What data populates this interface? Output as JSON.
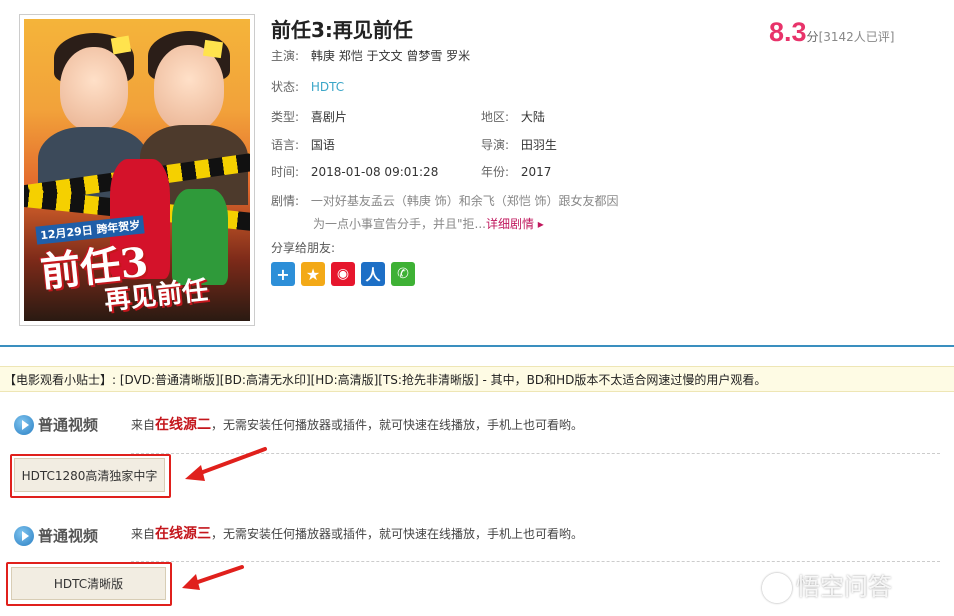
{
  "movie": {
    "title": "前任3:再见前任",
    "rating": "8.3",
    "rating_unit": "分",
    "rating_count": "[3142人已评]",
    "cast_label": "主演:",
    "cast": "韩庚 郑恺 于文文 曾梦雪 罗米",
    "status_label": "状态:",
    "status": "HDTC",
    "genre_label": "类型:",
    "genre": "喜剧片",
    "region_label": "地区:",
    "region": "大陆",
    "language_label": "语言:",
    "language": "国语",
    "director_label": "导演:",
    "director": "田羽生",
    "time_label": "时间:",
    "time": "2018-01-08 09:01:28",
    "year_label": "年份:",
    "year": "2017",
    "plot_label": "剧情:",
    "plot_line1": "一对好基友孟云（韩庚 饰）和余飞（郑恺 饰）跟女友都因",
    "plot_line2": "为一点小事宣告分手，并且\"拒...",
    "plot_more": "详细剧情 ▸",
    "share_label": "分享给朋友:"
  },
  "poster": {
    "date": "12月29日 跨年贺岁",
    "title": "前任3",
    "subtitle": "再见前任"
  },
  "share_icons": [
    {
      "name": "plus-share-icon",
      "glyph": "+",
      "color": "#2d8fd8"
    },
    {
      "name": "qzone-share-icon",
      "glyph": "★",
      "color": "#f3a917"
    },
    {
      "name": "weibo-share-icon",
      "glyph": "◉",
      "color": "#e6162d"
    },
    {
      "name": "renren-share-icon",
      "glyph": "人",
      "color": "#1d6fc6"
    },
    {
      "name": "wechat-share-icon",
      "glyph": "✆",
      "color": "#3eb135"
    }
  ],
  "tips": "【电影观看小贴士】: [DVD:普通清晰版][BD:高清无水印][HD:高清版][TS:抢先非清晰版] - 其中，BD和HD版本不太适合网速过慢的用户观看。",
  "sources": [
    {
      "label": "普通视频",
      "desc_prefix": "来自",
      "desc_source": "在线源二",
      "desc_suffix": "，无需安装任何播放器或插件，就可快速在线播放，手机上也可看哟。",
      "episode": "HDTC1280高清独家中字"
    },
    {
      "label": "普通视频",
      "desc_prefix": "来自",
      "desc_source": "在线源三",
      "desc_suffix": "，无需安装任何播放器或插件，就可快速在线播放，手机上也可看哟。",
      "episode": "HDTC清晰版"
    }
  ],
  "watermark": "悟空问答",
  "colors": {
    "accent": "#3a8fbf",
    "rating": "#e8336a",
    "highlight_box": "#e0201c",
    "source_name": "#c4161c"
  }
}
